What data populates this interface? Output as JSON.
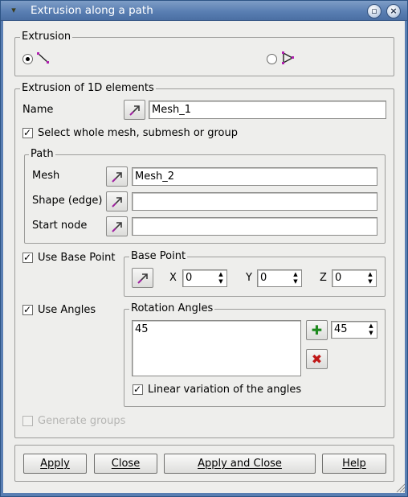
{
  "window": {
    "title": "Extrusion along a path"
  },
  "extrusion": {
    "legend": "Extrusion",
    "options": [
      {
        "icon": "edge-element-icon",
        "selected": true
      },
      {
        "icon": "face-element-icon",
        "selected": false
      }
    ]
  },
  "elements_1d": {
    "legend": "Extrusion of 1D elements",
    "name_label": "Name",
    "name_value": "Mesh_1",
    "select_whole_label": "Select whole mesh, submesh or group",
    "select_whole_checked": true
  },
  "path": {
    "legend": "Path",
    "mesh_label": "Mesh",
    "mesh_value": "Mesh_2",
    "shape_label": "Shape (edge)",
    "shape_value": "",
    "start_node_label": "Start node",
    "start_node_value": ""
  },
  "base_point": {
    "use_label": "Use Base Point",
    "use_checked": true,
    "legend": "Base Point",
    "x_label": "X",
    "x_value": "0",
    "y_label": "Y",
    "y_value": "0",
    "z_label": "Z",
    "z_value": "0"
  },
  "angles": {
    "use_label": "Use Angles",
    "use_checked": true,
    "legend": "Rotation Angles",
    "list": [
      "45"
    ],
    "spin_value": "45",
    "linear_label": "Linear variation of the angles",
    "linear_checked": true
  },
  "generate_groups": {
    "label": "Generate groups",
    "checked": false,
    "enabled": false
  },
  "buttons": {
    "apply": "Apply",
    "close": "Close",
    "apply_close": "Apply and Close",
    "help": "Help"
  }
}
